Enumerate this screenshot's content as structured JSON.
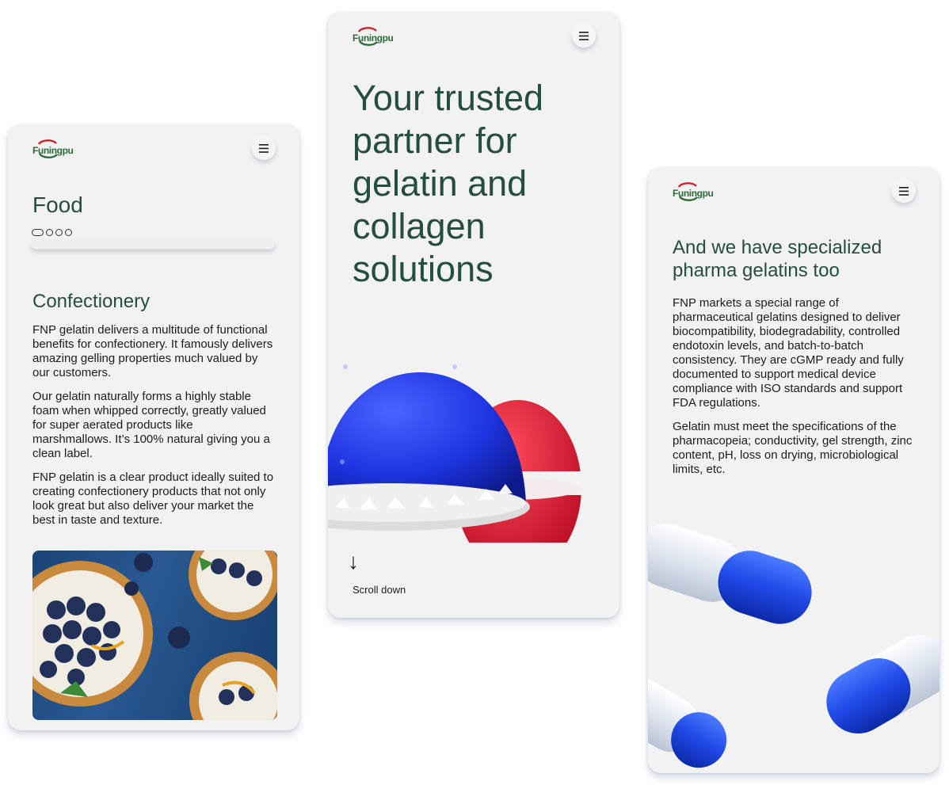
{
  "brand": {
    "logo_text": "Funingpu"
  },
  "screens": {
    "left": {
      "title": "Food",
      "carousel_pages": 4,
      "section_title": "Confectionery",
      "paragraphs": [
        "FNP gelatin delivers a multitude of functional benefits for confectionery. It famously delivers amazing gelling properties much valued by our customers.",
        "Our gelatin naturally forms a highly stable foam when whipped correctly, greatly valued for super aerated products like marshmallows. It’s 100% natural giving you a clean label.",
        "FNP gelatin is a clear product ideally suited to creating confectionery products that not only look great but also deliver your market the best in taste and texture."
      ]
    },
    "center": {
      "hero_title": "Your trusted partner for gelatin and collagen solutions",
      "arrow_glyph": "↓",
      "scroll_label": "Scroll down"
    },
    "right": {
      "title": "And we have specialized pharma gelatins too",
      "paragraphs": [
        "FNP markets a special range of pharmaceutical gelatins designed to deliver biocompatibility, biodegradability, controlled endotoxin levels, and batch-to-batch consistency. They are cGMP ready and fully documented to support medical device compliance with ISO standards and support FDA regulations.",
        "Gelatin must meet the specifications of the pharmacopeia; conductivity, gel strength, zinc content, pH, loss on drying, microbiological limits, etc."
      ]
    }
  },
  "colors": {
    "heading": "#264d42",
    "card_bg": "#f2f2f2",
    "brand_green": "#2e6b3a",
    "brand_red": "#d11f2a"
  }
}
